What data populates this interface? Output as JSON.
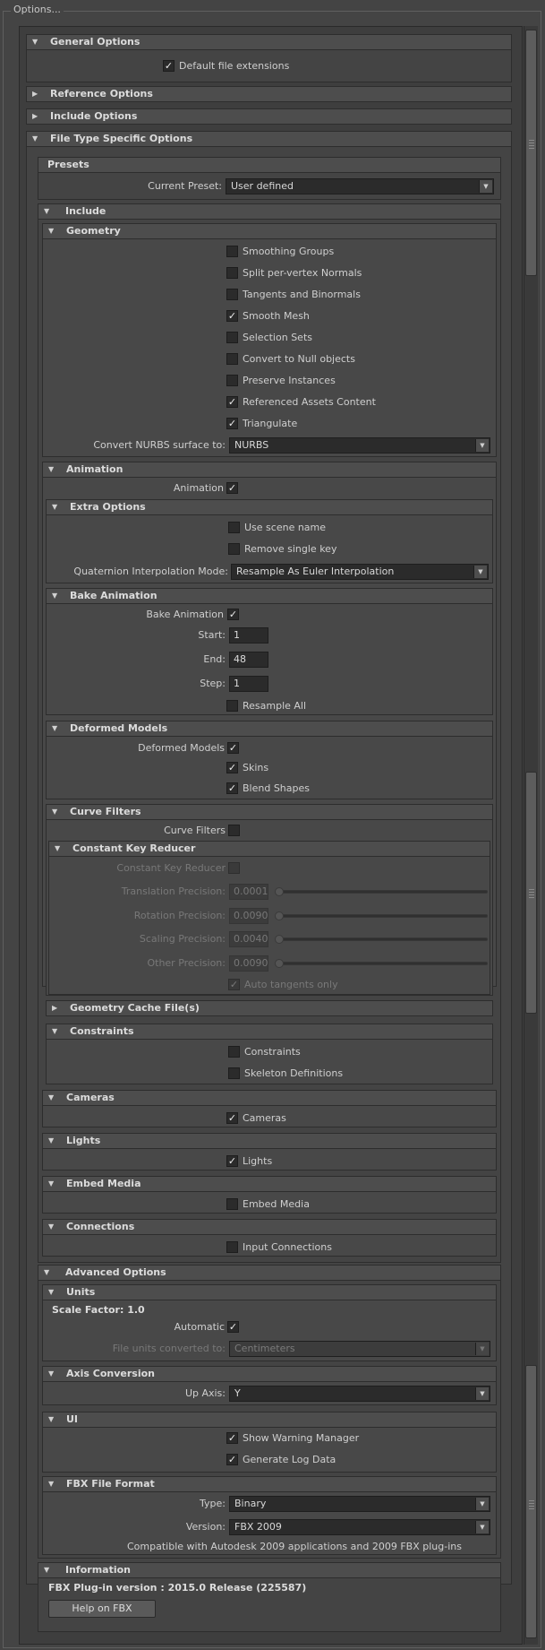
{
  "window": {
    "title": "Options..."
  },
  "general": {
    "header": "General Options",
    "default_ext": "Default file extensions"
  },
  "reference": {
    "header": "Reference Options"
  },
  "include_opts": {
    "header": "Include Options"
  },
  "filetype": {
    "header": "File Type Specific Options"
  },
  "presets": {
    "header": "Presets",
    "current_label": "Current Preset:",
    "current_value": "User defined"
  },
  "include": {
    "header": "Include"
  },
  "geometry": {
    "header": "Geometry",
    "items": [
      {
        "label": "Smoothing Groups",
        "checked": false
      },
      {
        "label": "Split per-vertex Normals",
        "checked": false
      },
      {
        "label": "Tangents and Binormals",
        "checked": false
      },
      {
        "label": "Smooth Mesh",
        "checked": true
      },
      {
        "label": "Selection Sets",
        "checked": false
      },
      {
        "label": "Convert to Null objects",
        "checked": false
      },
      {
        "label": "Preserve Instances",
        "checked": false
      },
      {
        "label": "Referenced Assets Content",
        "checked": true
      },
      {
        "label": "Triangulate",
        "checked": true
      }
    ],
    "nurbs_label": "Convert NURBS surface to:",
    "nurbs_value": "NURBS"
  },
  "animation": {
    "header": "Animation",
    "label": "Animation"
  },
  "extra": {
    "header": "Extra Options",
    "use_scene_name": "Use scene name",
    "remove_single_key": "Remove single key",
    "quat_label": "Quaternion Interpolation Mode:",
    "quat_value": "Resample As Euler Interpolation"
  },
  "bake": {
    "header": "Bake Animation",
    "label": "Bake Animation",
    "start_label": "Start:",
    "start_value": "1",
    "end_label": "End:",
    "end_value": "48",
    "step_label": "Step:",
    "step_value": "1",
    "resample_all": "Resample All"
  },
  "deformed": {
    "header": "Deformed Models",
    "label": "Deformed Models",
    "skins": "Skins",
    "blend": "Blend Shapes"
  },
  "curve": {
    "header": "Curve Filters",
    "label": "Curve Filters"
  },
  "ckr": {
    "header": "Constant Key Reducer",
    "label": "Constant Key Reducer",
    "translation_label": "Translation Precision:",
    "translation_value": "0.0001",
    "rotation_label": "Rotation Precision:",
    "rotation_value": "0.0090",
    "scaling_label": "Scaling Precision:",
    "scaling_value": "0.0040",
    "other_label": "Other Precision:",
    "other_value": "0.0090",
    "auto_tangents": "Auto tangents only"
  },
  "geocache": {
    "header": "Geometry Cache File(s)"
  },
  "constraints": {
    "header": "Constraints",
    "constraints": "Constraints",
    "skeleton": "Skeleton Definitions"
  },
  "cameras": {
    "header": "Cameras",
    "label": "Cameras"
  },
  "lights": {
    "header": "Lights",
    "label": "Lights"
  },
  "embed": {
    "header": "Embed Media",
    "label": "Embed Media"
  },
  "connections": {
    "header": "Connections",
    "label": "Input Connections"
  },
  "advanced": {
    "header": "Advanced Options"
  },
  "units": {
    "header": "Units",
    "scale_factor": "Scale Factor: 1.0",
    "automatic": "Automatic",
    "converted_label": "File units converted to:",
    "converted_value": "Centimeters"
  },
  "axis": {
    "header": "Axis Conversion",
    "up_label": "Up Axis:",
    "up_value": "Y"
  },
  "ui": {
    "header": "UI",
    "show_warning": "Show Warning Manager",
    "gen_log": "Generate Log Data"
  },
  "fbxformat": {
    "header": "FBX File Format",
    "type_label": "Type:",
    "type_value": "Binary",
    "version_label": "Version:",
    "version_value": "FBX 2009",
    "compat": "Compatible with Autodesk 2009 applications and 2009 FBX plug-ins"
  },
  "information": {
    "header": "Information",
    "version": "FBX Plug-in version :  2015.0 Release (225587)",
    "help_button": "Help on FBX"
  },
  "icons": {
    "expanded": "triangle-down-icon",
    "collapsed": "triangle-right-icon",
    "check": "checkmark-icon",
    "combo": "combo-arrow-icon"
  },
  "colors": {
    "background": "#444444",
    "field": "#2b2b2b",
    "header": "#4d4d4d",
    "text": "#cfcfcf"
  }
}
